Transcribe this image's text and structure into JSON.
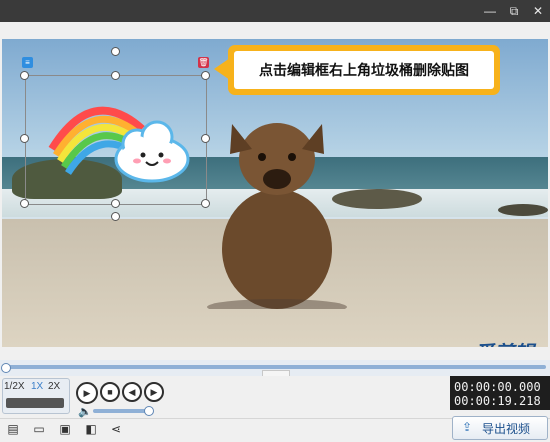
{
  "titlebar": {
    "minimize_glyph": "—",
    "restore_glyph": "⧉",
    "close_glyph": "✕"
  },
  "hint": {
    "text": "点击编辑框右上角垃圾桶删除贴图"
  },
  "watermark": {
    "text": "爱剪辑"
  },
  "player": {
    "speeds": [
      "1/2X",
      "1X",
      "2X"
    ],
    "active_speed": "1X",
    "current_time": "00:00:00.000",
    "total_time": "00:00:19.218",
    "volume_fraction": 0.9,
    "progress_fraction": 0.0
  },
  "export": {
    "label": "导出视频"
  },
  "icons": {
    "trash": "trash-icon",
    "list": "list-icon"
  },
  "colors": {
    "accent": "#3a7fc9",
    "hint_border": "#f7b21b",
    "trash": "#d2334a"
  }
}
